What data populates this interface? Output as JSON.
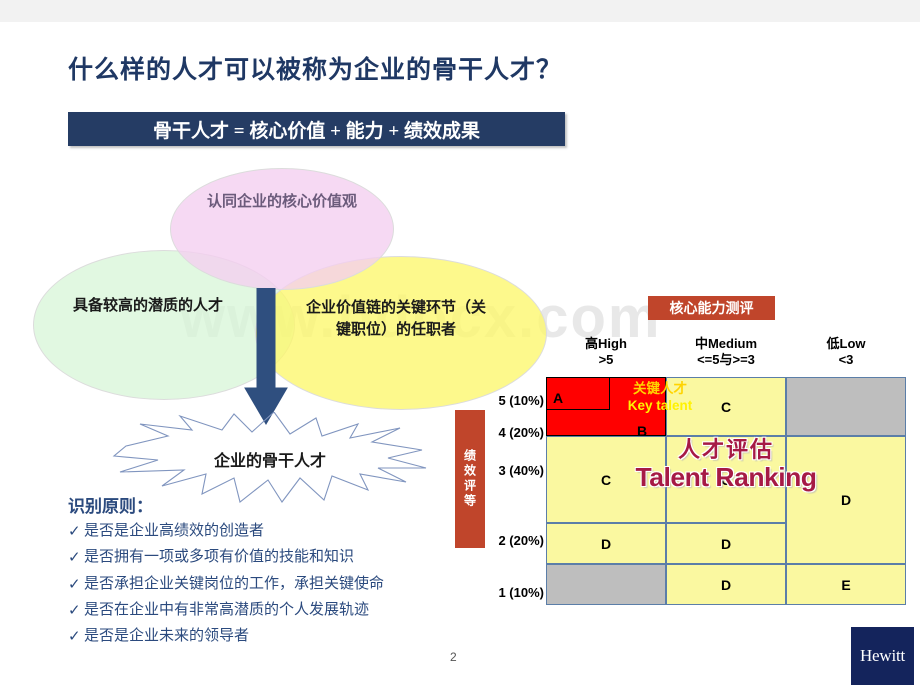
{
  "slide": {
    "title": "什么样的人才可以被称为企业的骨干人才？",
    "equation": "骨干人才 = 核心价值 + 能力 + 绩效成果",
    "page_number": "2",
    "watermark": "www.bdocx.com",
    "logo_text": "Hewitt",
    "colors": {
      "title": "#1F3864",
      "equation_bar": "#253C64",
      "accent_red": "#C0452B",
      "key_talent_red": "#FF0000",
      "cell_yellow": "#FAF8A0",
      "cell_gray": "#BEBEBE",
      "wordart": "#A61A45",
      "logo_navy": "#14245C"
    }
  },
  "venn": {
    "pink": "认同企业的核心价值观",
    "green": "具备较高的潜质的人才",
    "yellow": "企业价值链的关键环节（关键职位）的任职者",
    "result": "企业的骨干人才"
  },
  "principles": {
    "heading": "识别原则：",
    "check_mark": "✓",
    "items": [
      "是否是企业高绩效的创造者",
      "是否拥有一项或多项有价值的技能和知识",
      "是否承担企业关键岗位的工作，承担关键使命",
      "是否在企业中有非常高潜质的个人发展轨迹",
      "是否是企业未来的领导者"
    ]
  },
  "matrix": {
    "top_badge": "核心能力测评",
    "side_badge": "绩效评等",
    "columns": [
      {
        "cn": "高High",
        "range": ">5"
      },
      {
        "cn": "中Medium",
        "range": "<=5与>=3"
      },
      {
        "cn": "低Low",
        "range": "<3"
      }
    ],
    "rows": [
      {
        "label": "5 (10%)"
      },
      {
        "label": "4 (20%)"
      },
      {
        "label": "3 (40%)"
      },
      {
        "label": "2 (20%)"
      },
      {
        "label": "1 (10%)"
      }
    ],
    "key_talent": {
      "cn": "关键人才",
      "en": "Key talent",
      "grade_a": "A",
      "grade_b": "B"
    },
    "cells": {
      "high_3_2": "C",
      "med_5_4": "C",
      "med_3": "C",
      "med_2": "D",
      "med_1": "D",
      "low_3_2": "D",
      "low_1": "E",
      "high_2": "D"
    },
    "wordart_cn": "人才评估",
    "wordart_en": "Talent Ranking"
  }
}
